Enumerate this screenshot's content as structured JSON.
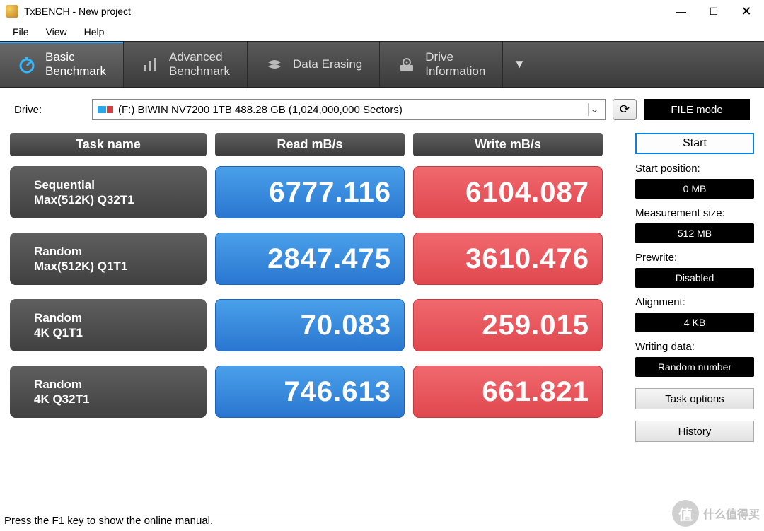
{
  "window": {
    "title": "TxBENCH - New project"
  },
  "menu": {
    "file": "File",
    "view": "View",
    "help": "Help"
  },
  "tabs": {
    "basic": {
      "l1": "Basic",
      "l2": "Benchmark"
    },
    "advanced": {
      "l1": "Advanced",
      "l2": "Benchmark"
    },
    "erase": {
      "l1": "Data Erasing"
    },
    "info": {
      "l1": "Drive",
      "l2": "Information"
    }
  },
  "drive": {
    "label": "Drive:",
    "selected": "(F:) BIWIN NV7200 1TB  488.28 GB (1,024,000,000 Sectors)",
    "filemode": "FILE mode"
  },
  "headers": {
    "task": "Task name",
    "read": "Read mB/s",
    "write": "Write mB/s"
  },
  "rows": [
    {
      "task1": "Sequential",
      "task2": "Max(512K) Q32T1",
      "read": "6777.116",
      "write": "6104.087"
    },
    {
      "task1": "Random",
      "task2": "Max(512K) Q1T1",
      "read": "2847.475",
      "write": "3610.476"
    },
    {
      "task1": "Random",
      "task2": "4K Q1T1",
      "read": "70.083",
      "write": "259.015"
    },
    {
      "task1": "Random",
      "task2": "4K Q32T1",
      "read": "746.613",
      "write": "661.821"
    }
  ],
  "sidebar": {
    "start": "Start",
    "startpos_label": "Start position:",
    "startpos": "0 MB",
    "meas_label": "Measurement size:",
    "meas": "512 MB",
    "prewrite_label": "Prewrite:",
    "prewrite": "Disabled",
    "align_label": "Alignment:",
    "align": "4 KB",
    "writing_label": "Writing data:",
    "writing": "Random number",
    "taskopt": "Task options",
    "history": "History"
  },
  "status": "Press the F1 key to show the online manual.",
  "watermark": {
    "badge": "值",
    "text": "什么值得买"
  },
  "chart_data": {
    "type": "table",
    "title": "TxBENCH Basic Benchmark results (MB/s)",
    "columns": [
      "Task",
      "Read",
      "Write"
    ],
    "rows": [
      [
        "Sequential Max(512K) Q32T1",
        6777.116,
        6104.087
      ],
      [
        "Random Max(512K) Q1T1",
        2847.475,
        3610.476
      ],
      [
        "Random 4K Q1T1",
        70.083,
        259.015
      ],
      [
        "Random 4K Q32T1",
        746.613,
        661.821
      ]
    ]
  }
}
